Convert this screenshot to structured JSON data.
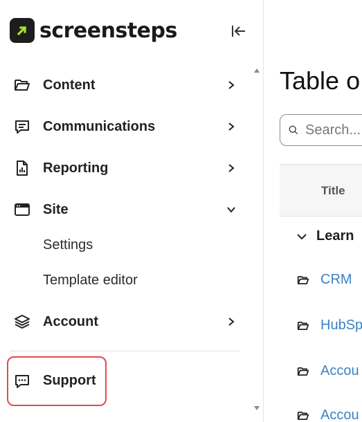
{
  "brand": {
    "name": "screensteps",
    "logo_color": "#a6e22e"
  },
  "sidebar": {
    "collapse_icon": "collapse-left-icon",
    "items": [
      {
        "label": "Content",
        "icon": "folder-open-icon",
        "state": "collapsed"
      },
      {
        "label": "Communications",
        "icon": "message-icon",
        "state": "collapsed"
      },
      {
        "label": "Reporting",
        "icon": "report-icon",
        "state": "collapsed"
      },
      {
        "label": "Site",
        "icon": "browser-window-icon",
        "state": "expanded",
        "children": [
          {
            "label": "Settings"
          },
          {
            "label": "Template editor"
          }
        ]
      },
      {
        "label": "Account",
        "icon": "layers-icon",
        "state": "collapsed"
      }
    ],
    "support": {
      "label": "Support",
      "icon": "chat-dots-icon",
      "highlight_color": "#e5484d"
    }
  },
  "main": {
    "title": "Table o",
    "search": {
      "placeholder": "Search..."
    },
    "table": {
      "column_title": "Title",
      "group": "Learn",
      "rows": [
        {
          "label": "CRM"
        },
        {
          "label": "HubSp"
        },
        {
          "label": "Accou"
        },
        {
          "label": "Accou"
        }
      ]
    },
    "link_color": "#3b82c4"
  }
}
